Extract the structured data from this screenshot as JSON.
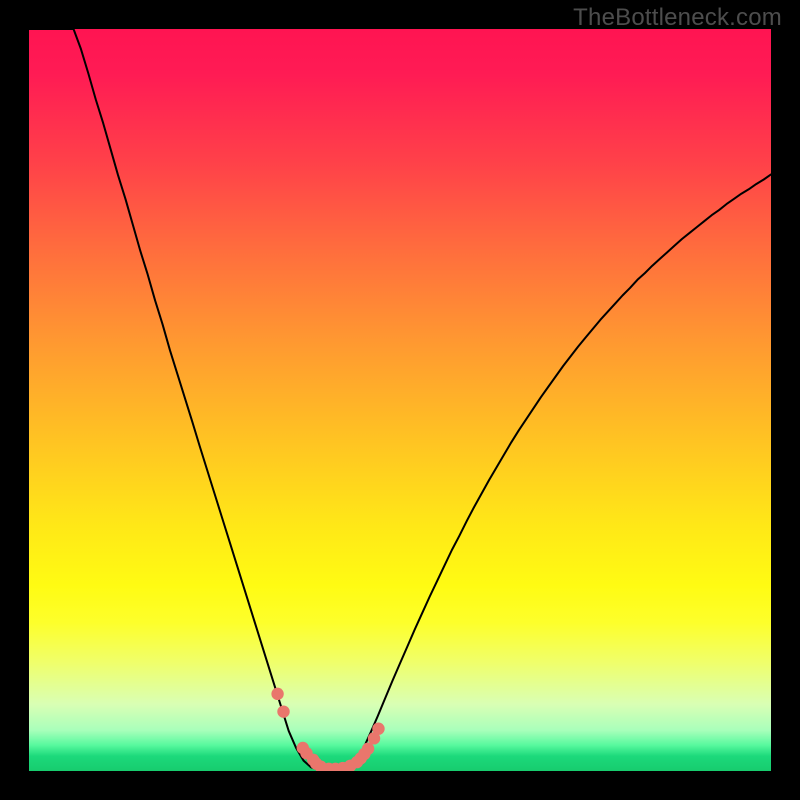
{
  "watermark": "TheBottleneck.com",
  "colors": {
    "page_bg": "#000000",
    "curve_stroke": "#000000",
    "dot_fill": "#e9766c",
    "gradient_top": "#ff1452",
    "gradient_bottom": "#17cc6e"
  },
  "chart_data": {
    "type": "line",
    "title": "",
    "xlabel": "",
    "ylabel": "",
    "xlim": [
      0,
      100
    ],
    "ylim": [
      0,
      100
    ],
    "x": [
      0,
      1,
      2,
      3,
      4,
      5,
      6,
      7,
      8,
      9,
      10,
      11,
      12,
      13,
      14,
      15,
      16,
      17,
      18,
      19,
      20,
      21,
      22,
      23,
      24,
      25,
      26,
      27,
      28,
      29,
      30,
      31,
      32,
      33,
      34,
      35,
      36,
      37,
      38,
      39,
      40,
      41,
      42,
      43,
      44,
      45,
      46,
      47,
      48,
      49,
      50,
      51,
      52,
      53,
      54,
      55,
      56,
      57,
      58,
      59,
      60,
      61,
      62,
      63,
      64,
      65,
      66,
      67,
      68,
      69,
      70,
      71,
      72,
      73,
      74,
      75,
      76,
      77,
      78,
      79,
      80,
      81,
      82,
      83,
      84,
      85,
      86,
      87,
      88,
      89,
      90,
      91,
      92,
      93,
      94,
      95,
      96,
      97,
      98,
      99,
      100
    ],
    "values": [
      100,
      100,
      100,
      100,
      100,
      100,
      100,
      97.3,
      94.0,
      90.5,
      87.3,
      83.8,
      80.3,
      77.1,
      73.6,
      70.1,
      66.9,
      63.4,
      60.2,
      56.7,
      53.5,
      50.3,
      47.1,
      43.8,
      40.6,
      37.4,
      34.2,
      31.0,
      27.8,
      24.6,
      21.4,
      18.2,
      15.0,
      11.8,
      8.6,
      5.4,
      3.1,
      1.4,
      0.5,
      0.2,
      0.1,
      0.1,
      0.2,
      0.5,
      1.3,
      2.9,
      5.1,
      7.4,
      9.8,
      12.2,
      14.5,
      16.8,
      19.1,
      21.3,
      23.5,
      25.6,
      27.7,
      29.8,
      31.7,
      33.7,
      35.6,
      37.4,
      39.2,
      40.9,
      42.6,
      44.3,
      45.9,
      47.4,
      48.9,
      50.4,
      51.8,
      53.2,
      54.6,
      55.9,
      57.2,
      58.4,
      59.6,
      60.8,
      61.9,
      63.0,
      64.1,
      65.1,
      66.2,
      67.1,
      68.1,
      69.0,
      69.9,
      70.8,
      71.7,
      72.5,
      73.3,
      74.1,
      74.9,
      75.6,
      76.4,
      77.1,
      77.8,
      78.4,
      79.1,
      79.7,
      80.4
    ],
    "dots": {
      "x": [
        33.5,
        34.3,
        36.9,
        37.4,
        38.3,
        38.7,
        39.3,
        40.4,
        41.3,
        42.3,
        43.3,
        44.2,
        44.7,
        45.2,
        45.7,
        46.5,
        47.1
      ],
      "y": [
        10.4,
        8.0,
        3.1,
        2.4,
        1.5,
        1.0,
        0.6,
        0.3,
        0.3,
        0.4,
        0.7,
        1.2,
        1.7,
        2.3,
        3.0,
        4.4,
        5.7
      ]
    },
    "notes": "Axes are implied (no ticks/labels rendered). x spans 0–100 left→right; y spans 0–100 bottom→top. Background gradient encodes a continuous color scale from red (top, high y) to green (bottom, low y). The black curve is a V-shaped bottleneck function; pink dots cluster near its minimum."
  }
}
